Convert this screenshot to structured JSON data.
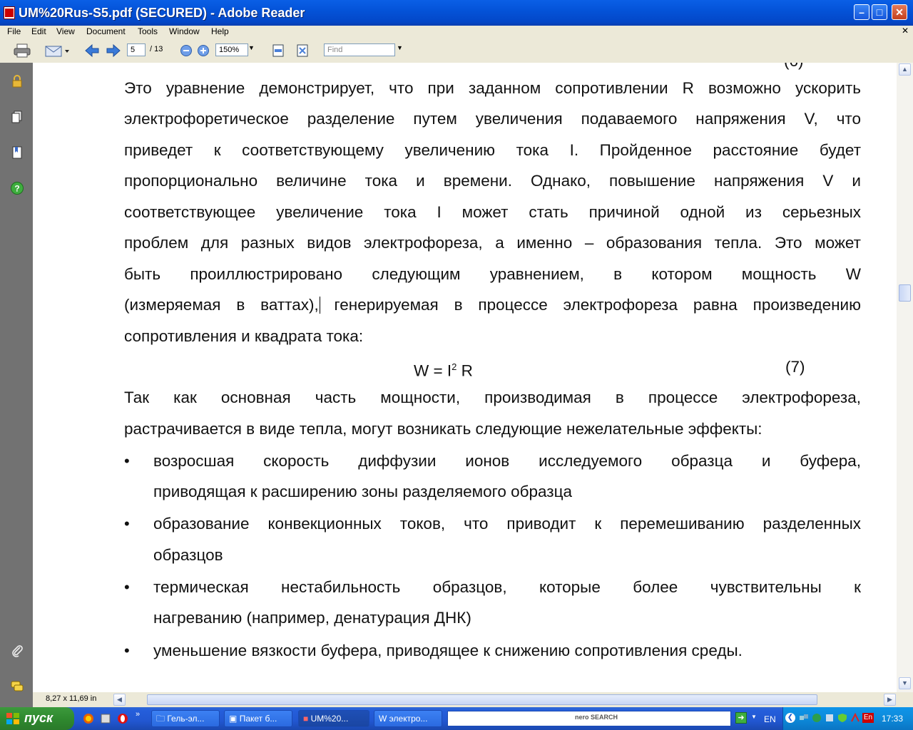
{
  "window": {
    "title": "UM%20Rus-S5.pdf (SECURED) - Adobe Reader"
  },
  "menu": {
    "items": [
      "File",
      "Edit",
      "View",
      "Document",
      "Tools",
      "Window",
      "Help"
    ]
  },
  "toolbar": {
    "page_current": "5",
    "page_total": "/ 13",
    "zoom": "150%",
    "find_placeholder": "Find"
  },
  "document": {
    "partial_top_number": "(6)",
    "para1": [
      "Это уравнение демонстрирует, что при заданном сопротивлении R возможно ускорить",
      "электрофоретическое разделение путем увеличения подаваемого напряжения V, что",
      "приведет к соответствующему увеличению тока I. Пройденное расстояние будет",
      "пропорционально величине тока и времени. Однако, повышение напряжения V и",
      "соответствующее увеличение тока I может стать причиной одной из серьезных",
      "проблем для разных видов электрофореза, а именно – образования тепла. Это может",
      "быть проиллюстрировано следующим уравнением, в котором мощность W",
      "(измеряемая в ваттах), генерируемая в процессе электрофореза равна произведению"
    ],
    "para1_last": "сопротивления и квадрата тока:",
    "equation": {
      "lhs": "W = I",
      "sup": "2",
      "rhs": " R",
      "number": "(7)"
    },
    "para2": [
      "Так как основная часть мощности, производимая в процессе электрофореза,"
    ],
    "para2_last": "растрачивается в виде тепла, могут возникать следующие нежелательные эффекты:",
    "bullet_char": "•",
    "bullets": [
      {
        "l1": "возросшая скорость диффузии ионов исследуемого образца и буфера,",
        "l2": "приводящая к расширению зоны разделяемого образца"
      },
      {
        "l1": "образование конвекционных токов, что приводит к перемешиванию разделенных",
        "l2": "образцов"
      },
      {
        "l1": "термическая нестабильность образцов, которые более чувствительны к",
        "l2": "нагреванию (например, денатурация ДНК)"
      },
      {
        "l1": "уменьшение вязкости буфера, приводящее к снижению сопротивления среды.",
        "l2": ""
      }
    ]
  },
  "status": {
    "page_size": "8,27 x 11,69 in"
  },
  "taskbar": {
    "start_label": "пуск",
    "tasks": [
      "Гель-эл...",
      "Пакет б...",
      "UM%20...",
      "электро..."
    ],
    "search_logo": "nero SEARCH",
    "lang": "EN",
    "lang_badge": "En",
    "clock": "17:33"
  },
  "colors": {
    "title_bar": "#0453D8",
    "nav_panel": "#727272",
    "taskbar": "#245EDB",
    "start": "#2F8A2F"
  }
}
